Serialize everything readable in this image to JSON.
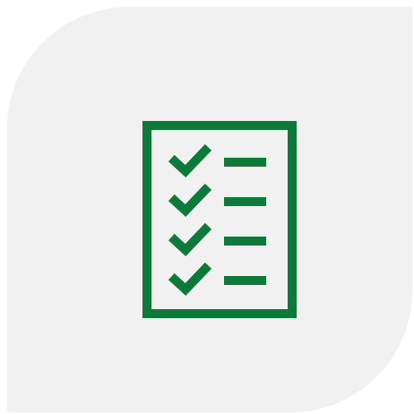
{
  "tile": {
    "background": "#f1f1f1"
  },
  "icon": {
    "name": "checklist-icon",
    "color": "#0e7a3a",
    "items": [
      {
        "checked": true
      },
      {
        "checked": true
      },
      {
        "checked": true
      },
      {
        "checked": true
      }
    ]
  }
}
